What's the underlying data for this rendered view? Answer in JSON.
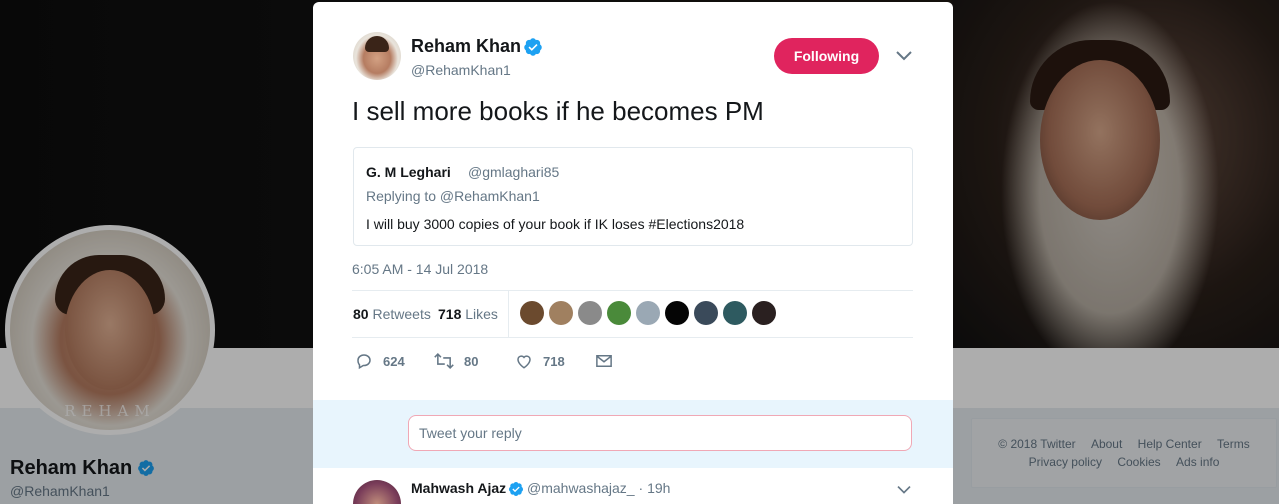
{
  "profile": {
    "name": "Reham Khan",
    "handle": "@RehamKhan1",
    "avatar_watermark": "REHAM"
  },
  "footer": {
    "row1": [
      "© 2018 Twitter",
      "About",
      "Help Center",
      "Terms"
    ],
    "row2": [
      "Privacy policy",
      "Cookies",
      "Ads info"
    ]
  },
  "tweet": {
    "author_name": "Reham Khan",
    "author_handle": "@RehamKhan1",
    "follow_label": "Following",
    "text": "I sell more books if he becomes PM",
    "timestamp": "6:05 AM - 14 Jul 2018",
    "retweets_count": "80",
    "retweets_label": "Retweets",
    "likes_count": "718",
    "likes_label": "Likes",
    "quoted": {
      "name": "G. M Leghari",
      "handle": "@gmlaghari85",
      "replying_to": "Replying to @RehamKhan1",
      "text": "I will buy 3000 copies of your book if IK loses #Elections2018"
    },
    "actions": {
      "replies": "624",
      "retweets": "80",
      "likes": "718"
    },
    "likers_colors": [
      "#6b4a2e",
      "#a08060",
      "#8a8a8a",
      "#4a8a3a",
      "#9aa8b4",
      "#050505",
      "#3a4a5a",
      "#2e5a60",
      "#2a2020"
    ]
  },
  "reply_box": {
    "placeholder": "Tweet your reply"
  },
  "first_reply": {
    "name": "Mahwash Ajaz",
    "handle": "@mahwashajaz_",
    "time": "19h"
  },
  "colors": {
    "following_button": "#e0245e",
    "verified": "#1da1f2",
    "secondary_text": "#657786"
  },
  "icons": [
    "verified-badge-icon",
    "chevron-down-icon",
    "reply-icon",
    "retweet-icon",
    "like-icon",
    "direct-message-icon"
  ]
}
